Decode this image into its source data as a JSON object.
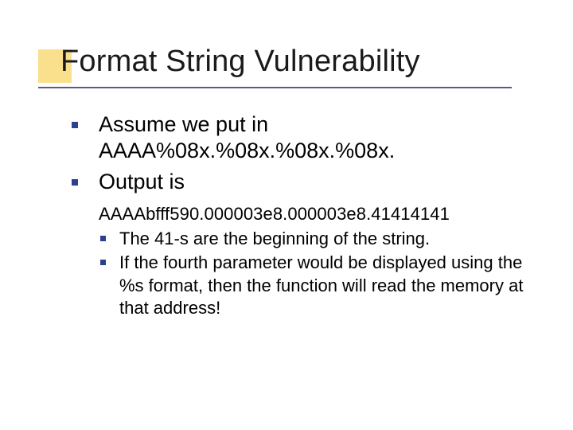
{
  "title": "Format String Vulnerability",
  "bullets_lvl1": [
    "Assume we put in AAAA%08x.%08x.%08x.%08x.",
    "Output is"
  ],
  "output_line": "AAAAbfff590.000003e8.000003e8.41414141",
  "bullets_lvl2": [
    "The 41-s are the beginning of the string.",
    "If the fourth parameter would be displayed using the %s format, then the function will read the memory at that address!"
  ],
  "colors": {
    "accent_block": "#fae08c",
    "rule": "#5a5a8a",
    "bullet": "#2f3f8f"
  }
}
